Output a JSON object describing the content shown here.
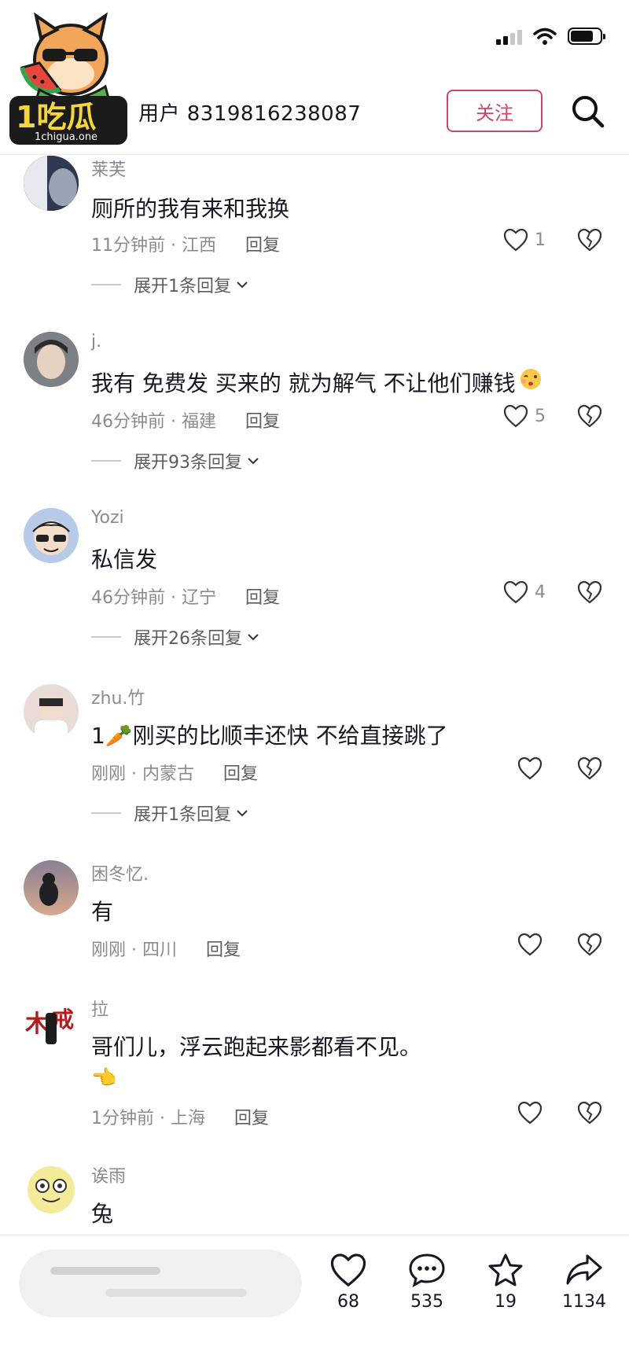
{
  "header": {
    "logo_text": "1吃瓜",
    "logo_domain": "1chigua.one",
    "username": "用户 8319816238087",
    "follow_label": "关注"
  },
  "comments": [
    {
      "name": "莱芙",
      "text": "厕所的我有来和我换",
      "time_location": "11分钟前 · 江西",
      "reply": "回复",
      "likes": "1",
      "expand": "展开1条回复",
      "avatar_color": "#3a4a6a"
    },
    {
      "name": "j.",
      "text": "我有 免费发 买来的 就为解气 不让他们赚钱",
      "time_location": "46分钟前 · 福建",
      "reply": "回复",
      "likes": "5",
      "expand": "展开93条回复",
      "avatar_color": "#8a8e92"
    },
    {
      "name": "Yozi",
      "text": "私信发",
      "time_location": "46分钟前 · 辽宁",
      "reply": "回复",
      "likes": "4",
      "expand": "展开26条回复",
      "avatar_color": "#9fb6d8"
    },
    {
      "name": "zhu.竹",
      "text": "1🥕刚买的比顺丰还快 不给直接跳了",
      "time_location": "刚刚 · 内蒙古",
      "reply": "回复",
      "likes": "",
      "expand": "展开1条回复",
      "avatar_color": "#d9c9c4"
    },
    {
      "name": "困冬忆.",
      "text": "有",
      "time_location": "刚刚 · 四川",
      "reply": "回复",
      "likes": "",
      "expand": "",
      "avatar_color": "#6a6070"
    },
    {
      "name": "拉",
      "text": "哥们儿，浮云跑起来影都看不见。",
      "text2": "👈",
      "time_location": "1分钟前 · 上海",
      "reply": "回复",
      "likes": "",
      "expand": "",
      "avatar_color": "#b01e1e"
    },
    {
      "name": "诶雨",
      "text": "兔",
      "avatar_color": "#f3ea9a"
    }
  ],
  "actions": {
    "like_count": "68",
    "comment_count": "535",
    "favorite_count": "19",
    "share_count": "1134"
  },
  "colors": {
    "accent": "#c9466a",
    "text_primary": "#161823",
    "text_secondary": "#8a8b91"
  }
}
